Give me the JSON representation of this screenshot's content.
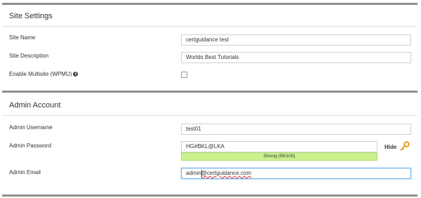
{
  "site_settings": {
    "title": "Site Settings",
    "site_name_label": "Site Name",
    "site_name_value": "certguidance test",
    "site_description_label": "Site Description",
    "site_description_value": "Worlds Best Tutorials",
    "multisite_label": "Enable Multisite (WPMU)",
    "multisite_checked": false
  },
  "admin_account": {
    "title": "Admin Account",
    "username_label": "Admin Username",
    "username_value": "test01",
    "password_label": "Admin Password",
    "password_value": "HG#BKL@LKA",
    "password_strength": "Strong (58/100)",
    "hide_label": "Hide",
    "email_label": "Admin Email",
    "email_value_prefix": "admin",
    "email_value_rest": "@certguidance.com"
  },
  "icons": {
    "info": "info-icon",
    "key": "key-icon"
  },
  "colors": {
    "strength_bar": "#c9f18e",
    "panel_border": "#8f8f8f",
    "focus_border": "#66afe9"
  }
}
